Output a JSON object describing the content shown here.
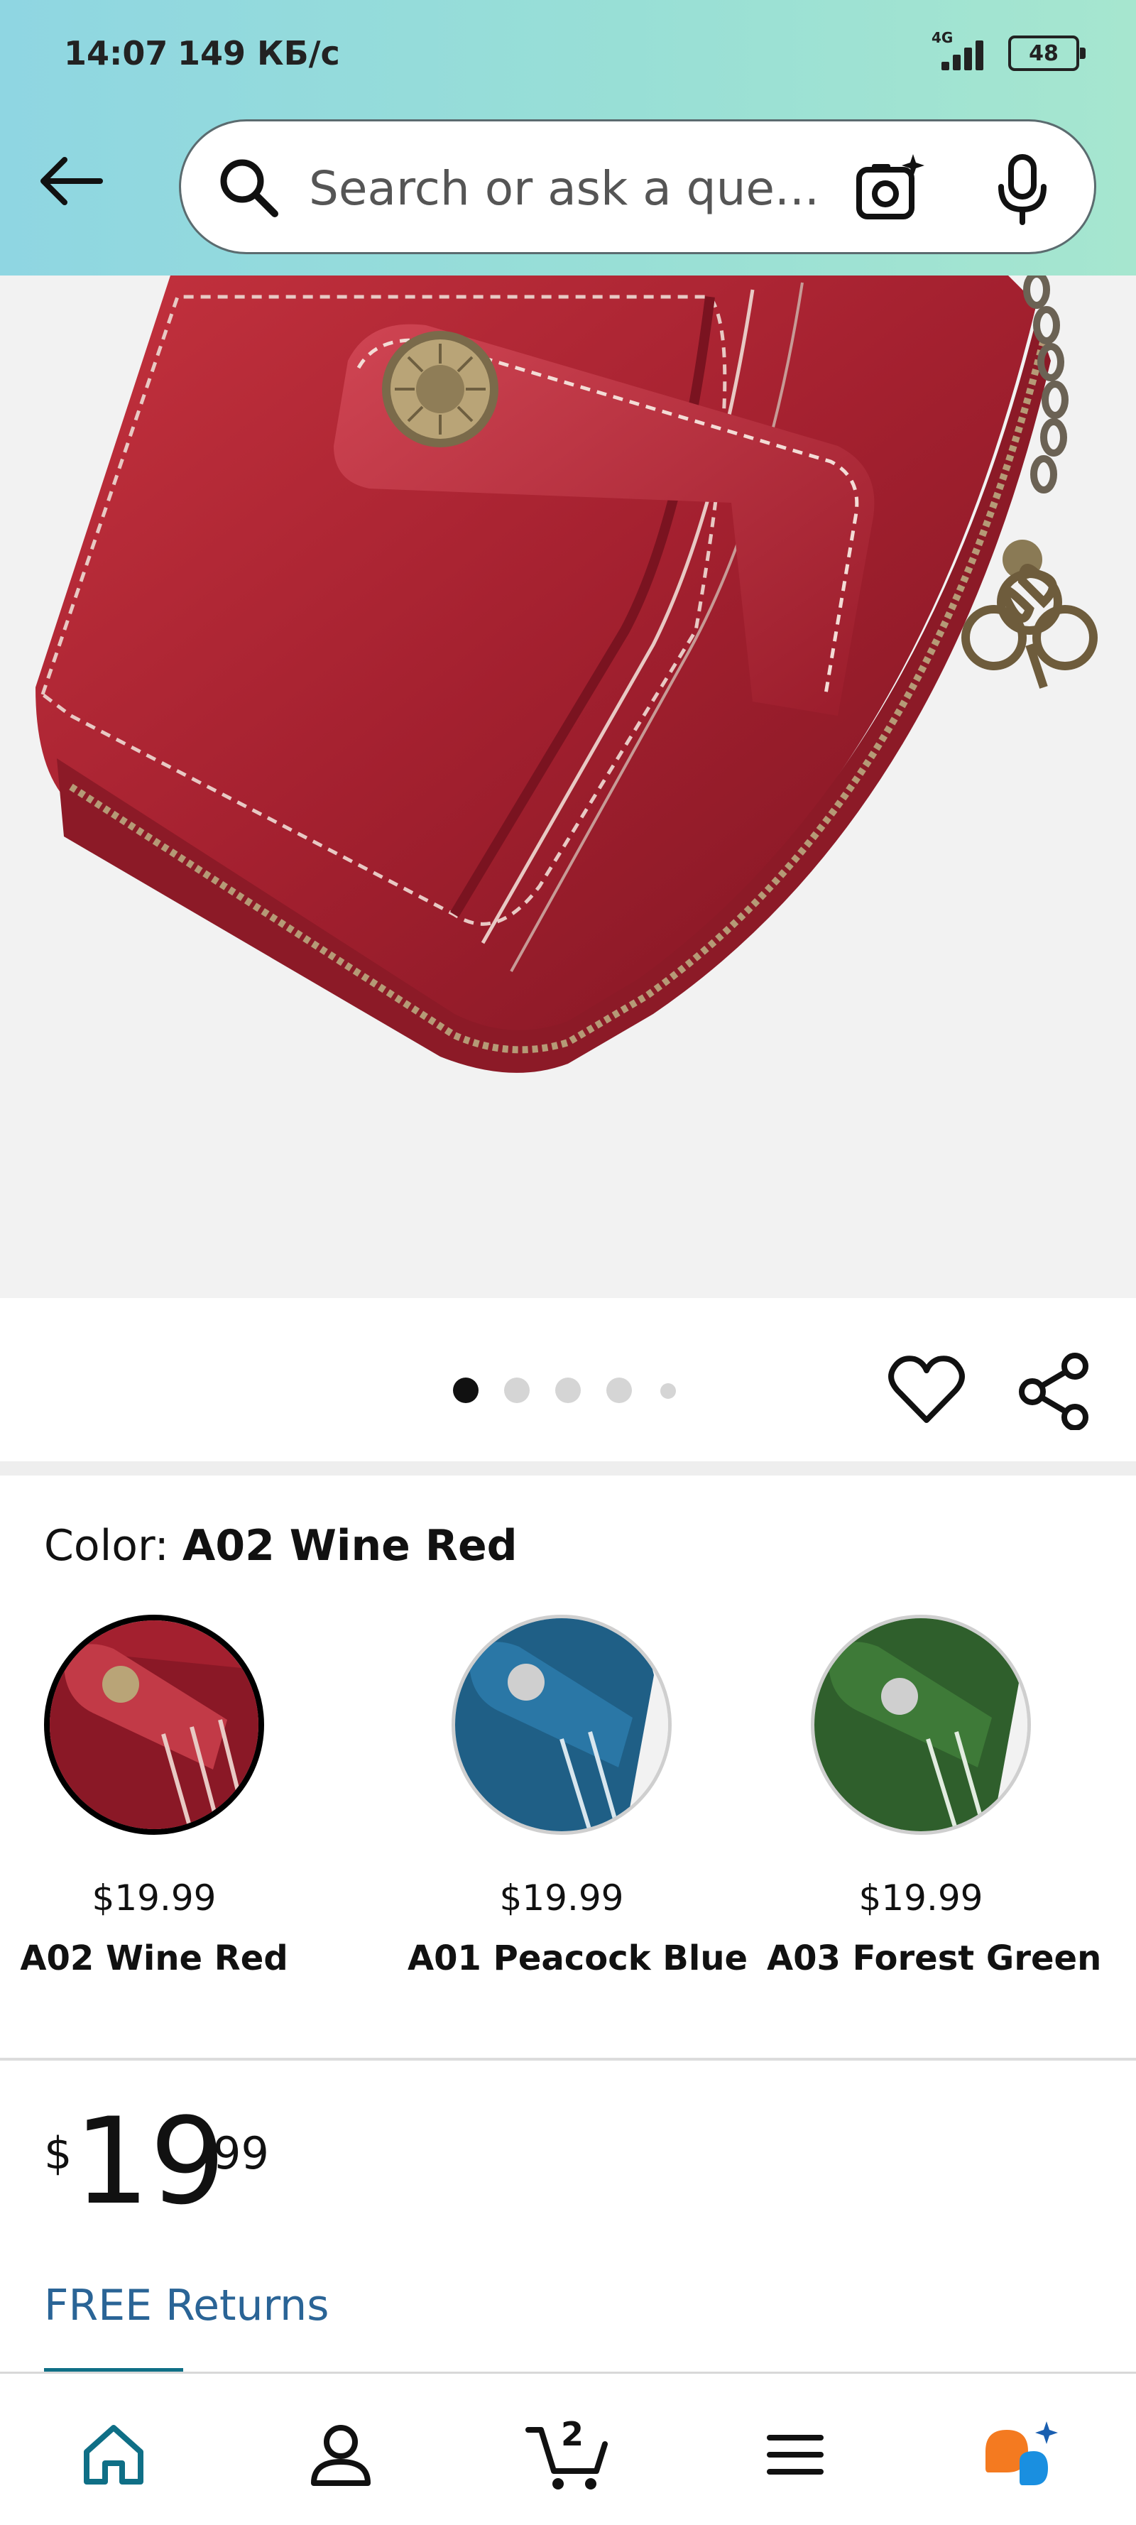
{
  "status_bar": {
    "time": "14:07",
    "speed": "149 КБ/с",
    "network": "4G",
    "battery": "48"
  },
  "search": {
    "placeholder": "Search or ask a que..."
  },
  "carousel": {
    "count": 5,
    "active_index": 0
  },
  "color": {
    "label": "Color: ",
    "selected": "A02 Wine Red",
    "options": [
      {
        "price": "$19.99",
        "name": "A02 Wine Red",
        "color": "#a3202f",
        "selected": true
      },
      {
        "price": "$19.99",
        "name": "A01 Peacock Blue",
        "color": "#1f5f86",
        "selected": false
      },
      {
        "price": "$19.99",
        "name": "A03 Forest Green",
        "color": "#2f5f2c",
        "selected": false
      }
    ]
  },
  "price": {
    "symbol": "$",
    "whole": "19",
    "fraction": "99"
  },
  "returns_label": "FREE Returns",
  "nav": {
    "cart_count": "2",
    "items": [
      "home-icon",
      "account-icon",
      "cart-icon",
      "menu-icon",
      "rufus-ai-icon"
    ]
  },
  "colors": {
    "header_gradient_start": "#8fd6e2",
    "header_gradient_end": "#a6e6cf",
    "link": "#2a6496",
    "nav_active": "#0f6f86",
    "ai_orange": "#f47a20",
    "ai_blue": "#1a8fe0"
  }
}
